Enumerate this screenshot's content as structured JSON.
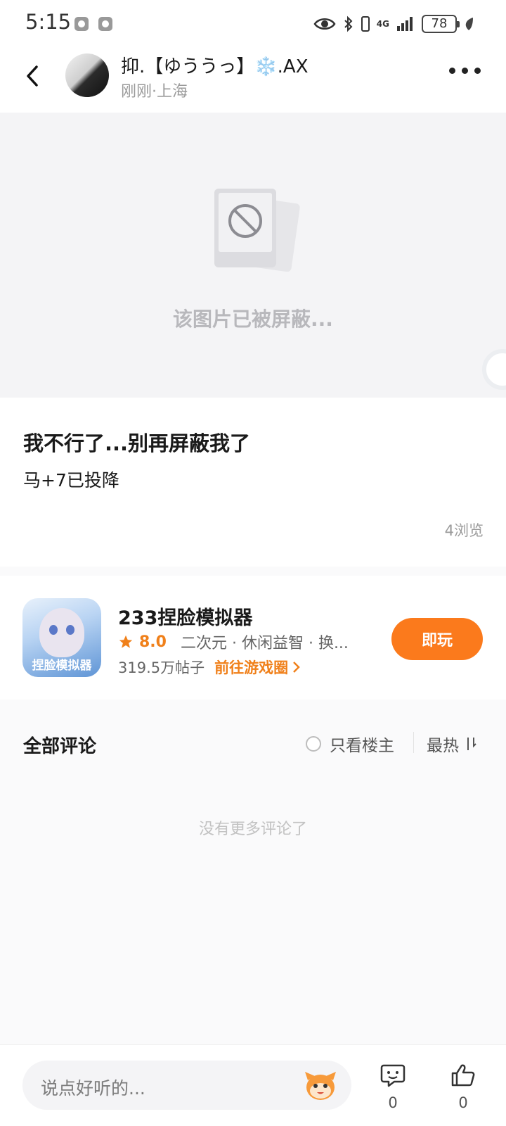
{
  "status_bar": {
    "time": "5:15",
    "network": "4G",
    "battery": "78"
  },
  "header": {
    "user_name": "抑.【ゆううっ】❄️.AX",
    "post_meta": "刚刚·上海"
  },
  "blocked_image": {
    "text": "该图片已被屏蔽..."
  },
  "post": {
    "title": "我不行了...别再屏蔽我了",
    "body": "马+7已投降",
    "views": "4浏览"
  },
  "game": {
    "name": "233捏脸模拟器",
    "icon_label": "捏脸模拟器",
    "score": "8.0",
    "tags": "二次元 · 休闲益智 · 换...",
    "posts": "319.5万帖子",
    "link_label": "前往游戏圈",
    "play_label": "即玩",
    "accent_color": "#fb7a1c"
  },
  "comments": {
    "title": "全部评论",
    "owner_only_label": "只看楼主",
    "sort_label": "最热",
    "empty_text": "没有更多评论了"
  },
  "bottom_bar": {
    "input_placeholder": "说点好听的...",
    "comment_count": "0",
    "like_count": "0"
  }
}
